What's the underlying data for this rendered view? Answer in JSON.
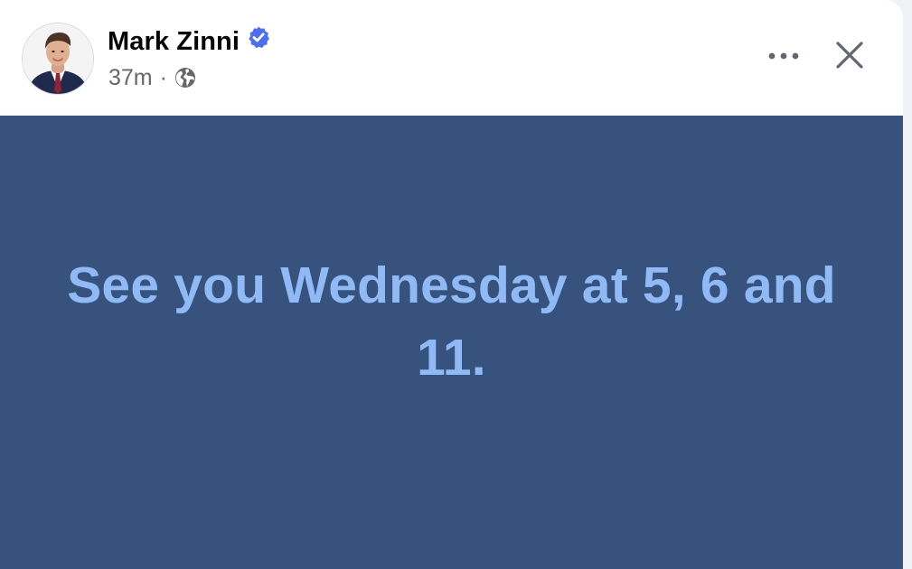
{
  "post": {
    "author": {
      "name": "Mark Zinni",
      "verified": true
    },
    "timestamp": "37m",
    "separator": "·",
    "audience_icon": "globe-icon",
    "actions": {
      "more_icon": "more-options-icon",
      "close_icon": "close-icon"
    },
    "message": "See you Wednesday at 5, 6 and 11."
  },
  "colors": {
    "body_background": "#38527e",
    "message_text": "#8fbaf5",
    "verified_badge": "#4c6ef5",
    "meta_text": "#65676b",
    "header_background": "#ffffff"
  }
}
